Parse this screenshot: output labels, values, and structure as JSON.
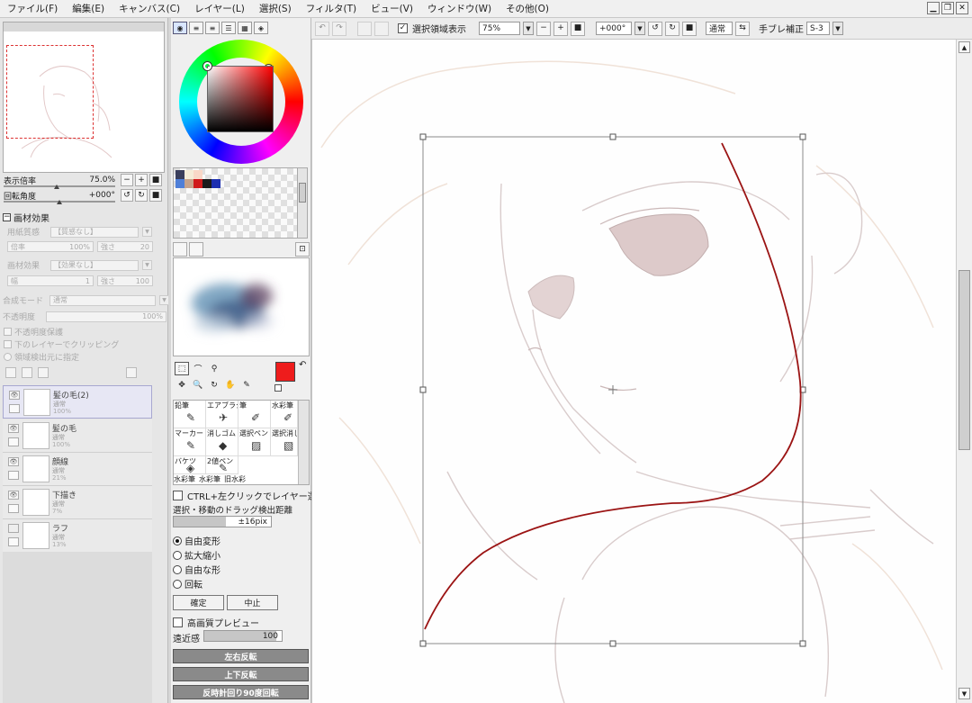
{
  "menu": [
    "ファイル(F)",
    "編集(E)",
    "キャンバス(C)",
    "レイヤー(L)",
    "選択(S)",
    "フィルタ(T)",
    "ビュー(V)",
    "ウィンドウ(W)",
    "その他(O)"
  ],
  "toolbar": {
    "show_selection_label": "選択領域表示",
    "zoom": "75%",
    "angle": "+000°",
    "blend": "通常",
    "stabilizer_label": "手ブレ補正",
    "stabilizer": "S-3"
  },
  "navigator": {
    "zoom_label": "表示倍率",
    "zoom_value": "75.0%",
    "rotate_label": "回転角度",
    "rotate_value": "+000°"
  },
  "paper": {
    "title": "画材効果",
    "texture_label": "用紙質感",
    "texture_value": "【質感なし】",
    "scale_label": "倍率",
    "scale_value": "100%",
    "strength_label": "強さ",
    "strength_value": "20",
    "effect_label": "画材効果",
    "effect_value": "【効果なし】",
    "width_label": "幅",
    "width_value": "1",
    "strength2_label": "強さ",
    "strength2_value": "100"
  },
  "layer_props": {
    "blend_label": "合成モード",
    "blend_value": "通常",
    "opacity_label": "不透明度",
    "opacity_value": "100%",
    "preserve_opacity": "不透明度保護",
    "clip_below": "下のレイヤーでクリッピング",
    "selection_source": "領域検出元に指定"
  },
  "layers": [
    {
      "name": "髪の毛(2)",
      "mode": "通常",
      "opacity": "100%",
      "selected": true
    },
    {
      "name": "髪の毛",
      "mode": "通常",
      "opacity": "100%",
      "selected": false
    },
    {
      "name": "顔線",
      "mode": "通常",
      "opacity": "21%",
      "selected": false
    },
    {
      "name": "下描き",
      "mode": "通常",
      "opacity": "7%",
      "selected": false
    },
    {
      "name": "ラフ",
      "mode": "通常",
      "opacity": "13%",
      "selected": false
    }
  ],
  "brushes": [
    [
      "鉛筆",
      "エアブラシ",
      "筆",
      "水彩筆"
    ],
    [
      "マーカー",
      "消しゴム",
      "選択ペン",
      "選択消し"
    ],
    [
      "バケツ",
      "2値ペン",
      "",
      ""
    ],
    [
      "水彩筆",
      "水彩筆",
      "旧水彩",
      ""
    ]
  ],
  "transform": {
    "ctrl_click": "CTRL+左クリックでレイヤー選択",
    "drag_distance_label": "選択・移動のドラッグ検出距離",
    "drag_distance": "±16pix",
    "modes": [
      "自由変形",
      "拡大縮小",
      "自由な形",
      "回転"
    ],
    "selected_mode": 0,
    "ok": "確定",
    "cancel": "中止",
    "hq_preview": "高画質プレビュー",
    "perspective_label": "遠近感",
    "perspective_value": "100",
    "flip_h": "左右反転",
    "flip_v": "上下反転",
    "rotate_ccw": "反時計回り90度回転"
  },
  "colors": {
    "foreground": "#ee1c1c",
    "background": "#ffffff",
    "curve": "#9b1414"
  }
}
